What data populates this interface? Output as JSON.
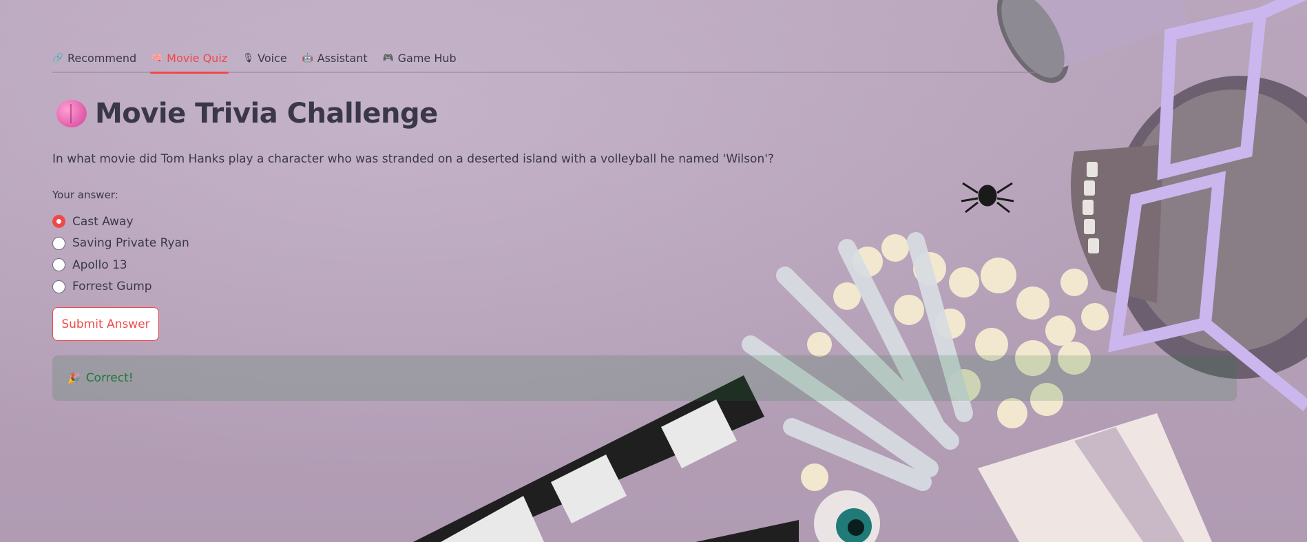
{
  "tabs": [
    {
      "label": "Recommend",
      "icon": "link-icon",
      "glyph": "🔗",
      "active": false
    },
    {
      "label": "Movie Quiz",
      "icon": "brain-icon",
      "glyph": "🧠",
      "active": true
    },
    {
      "label": "Voice",
      "icon": "microphone-icon",
      "glyph": "🎙",
      "active": false
    },
    {
      "label": "Assistant",
      "icon": "robot-icon",
      "glyph": "🤖",
      "active": false
    },
    {
      "label": "Game Hub",
      "icon": "gamepad-icon",
      "glyph": "🎮",
      "active": false
    }
  ],
  "page": {
    "title": "Movie Trivia Challenge",
    "title_icon": "brain-icon",
    "question": "In what movie did Tom Hanks play a character who was stranded on a deserted island with a volleyball he named 'Wilson'?",
    "answer_label": "Your answer:",
    "options": [
      "Cast Away",
      "Saving Private Ryan",
      "Apollo 13",
      "Forrest Gump"
    ],
    "selected_option": "Cast Away",
    "submit_label": "Submit Answer",
    "result": {
      "icon": "party-popper-icon",
      "glyph": "🎉",
      "text": "Correct!"
    }
  },
  "colors": {
    "accent": "#f04848",
    "background": "#b7a3b9",
    "success_text": "#1e7a37"
  }
}
